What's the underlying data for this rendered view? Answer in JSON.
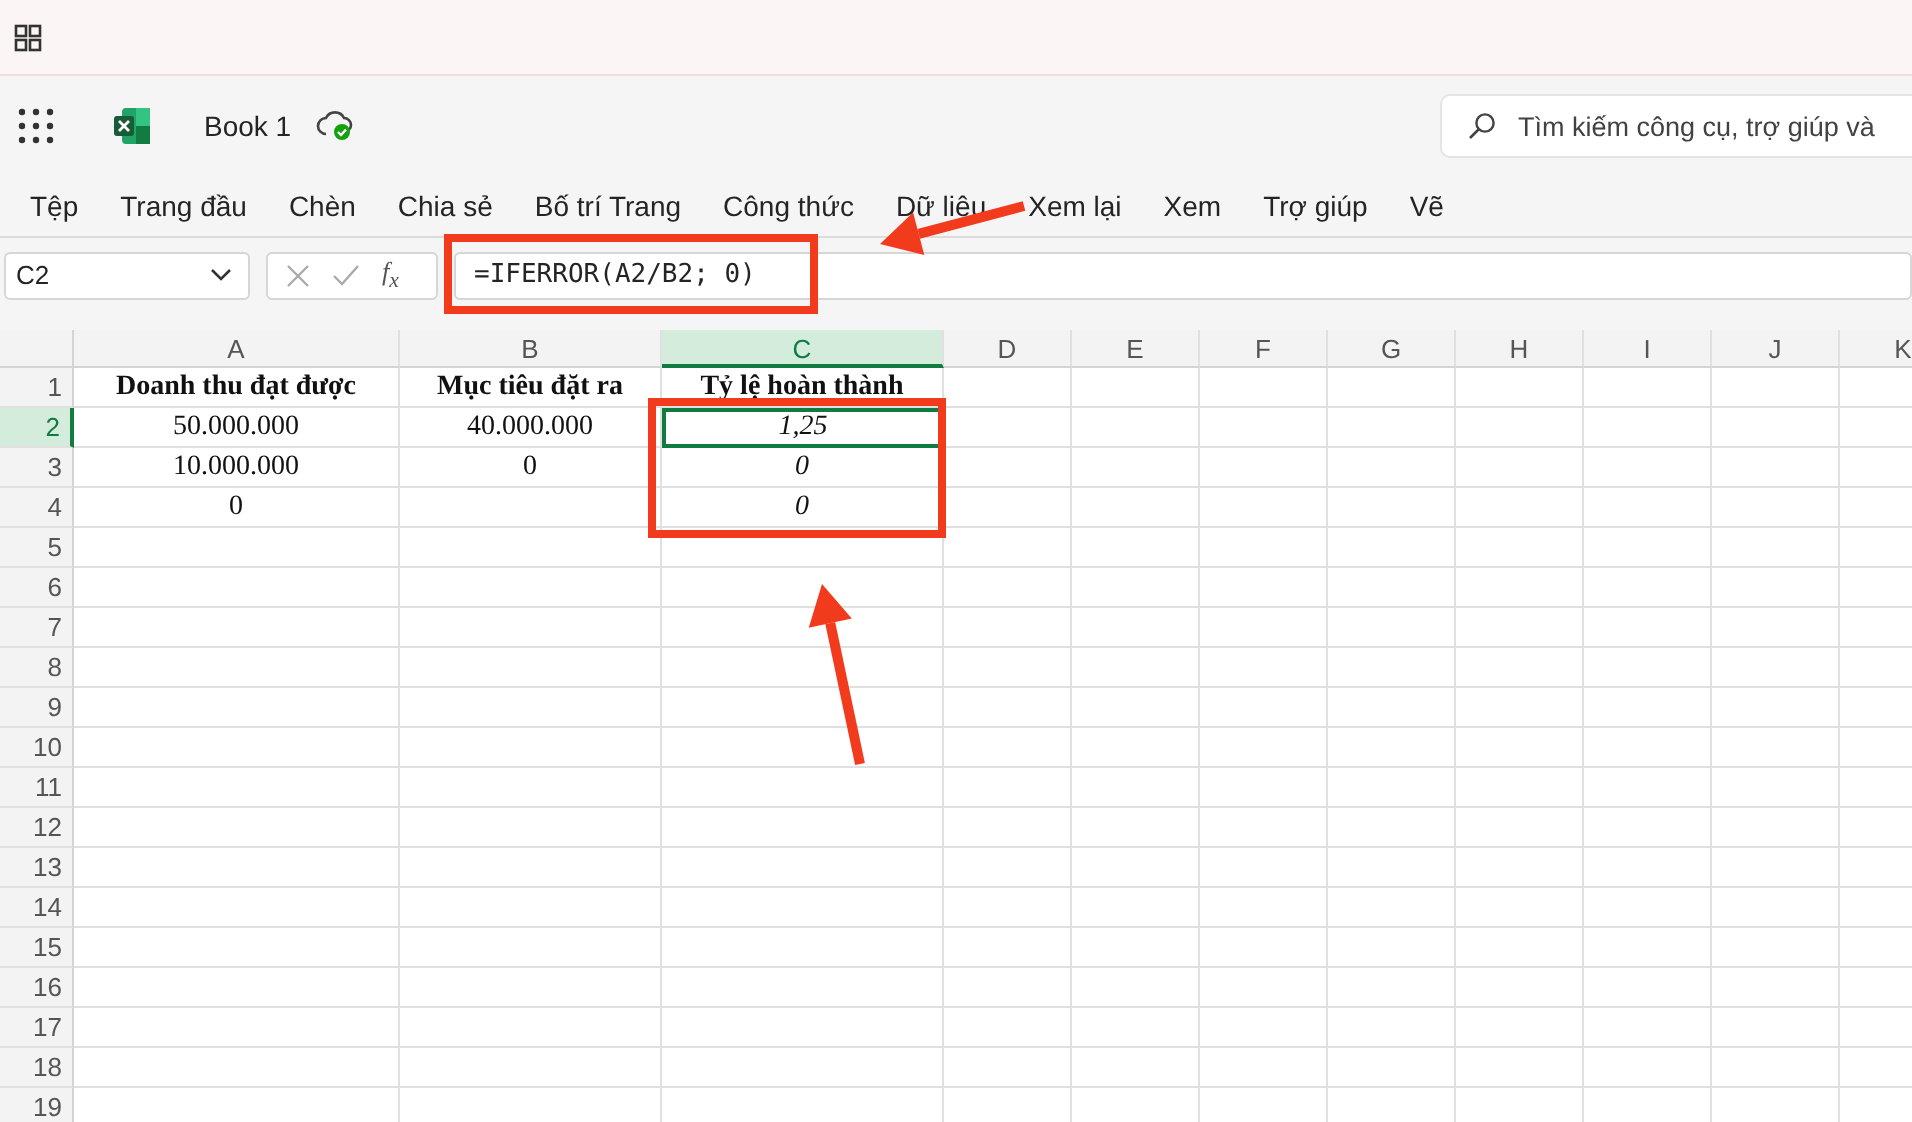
{
  "app": {
    "title": "Book 1"
  },
  "search": {
    "placeholder": "Tìm kiếm công cụ, trợ giúp và"
  },
  "ribbon_tabs": [
    "Tệp",
    "Trang đầu",
    "Chèn",
    "Chia sẻ",
    "Bố trí Trang",
    "Công thức",
    "Dữ liệu",
    "Xem lại",
    "Xem",
    "Trợ giúp",
    "Vẽ"
  ],
  "name_box": {
    "value": "C2"
  },
  "formula_bar": {
    "function_label": "f$_{x}$",
    "formula": "=IFERROR(A2/B2; 0)"
  },
  "columns": [
    {
      "label": "A",
      "selected": false
    },
    {
      "label": "B",
      "selected": false
    },
    {
      "label": "C",
      "selected": true
    },
    {
      "label": "D",
      "selected": false
    },
    {
      "label": "E",
      "selected": false
    },
    {
      "label": "F",
      "selected": false
    },
    {
      "label": "G",
      "selected": false
    },
    {
      "label": "H",
      "selected": false
    },
    {
      "label": "I",
      "selected": false
    },
    {
      "label": "J",
      "selected": false
    },
    {
      "label": "K",
      "selected": false
    }
  ],
  "rows": [
    {
      "label": "1",
      "selected": false,
      "cells": [
        {
          "text": "Doanh thu đạt được",
          "bold": true,
          "italic": false
        },
        {
          "text": "Mục tiêu đặt ra",
          "bold": true,
          "italic": false
        },
        {
          "text": "Tỷ lệ hoàn thành",
          "bold": true,
          "italic": false
        }
      ]
    },
    {
      "label": "2",
      "selected": true,
      "cells": [
        {
          "text": "50.000.000",
          "bold": false,
          "italic": false
        },
        {
          "text": "40.000.000",
          "bold": false,
          "italic": false
        },
        {
          "text": "1,25",
          "bold": false,
          "italic": true
        }
      ]
    },
    {
      "label": "3",
      "selected": false,
      "cells": [
        {
          "text": "10.000.000",
          "bold": false,
          "italic": false
        },
        {
          "text": "0",
          "bold": false,
          "italic": false
        },
        {
          "text": "0",
          "bold": false,
          "italic": true
        }
      ]
    },
    {
      "label": "4",
      "selected": false,
      "cells": [
        {
          "text": "0",
          "bold": false,
          "italic": false
        },
        null,
        {
          "text": "0",
          "bold": false,
          "italic": true
        }
      ]
    },
    {
      "label": "5",
      "selected": false
    },
    {
      "label": "6",
      "selected": false
    },
    {
      "label": "7",
      "selected": false
    },
    {
      "label": "8",
      "selected": false
    },
    {
      "label": "9",
      "selected": false
    },
    {
      "label": "10",
      "selected": false
    },
    {
      "label": "11",
      "selected": false
    },
    {
      "label": "12",
      "selected": false
    },
    {
      "label": "13",
      "selected": false
    },
    {
      "label": "14",
      "selected": false
    },
    {
      "label": "15",
      "selected": false
    },
    {
      "label": "16",
      "selected": false
    },
    {
      "label": "17",
      "selected": false
    },
    {
      "label": "18",
      "selected": false
    },
    {
      "label": "19",
      "selected": false
    }
  ],
  "annotations": [
    {
      "kind": "box"
    },
    {
      "kind": "arrow"
    },
    {
      "kind": "box"
    },
    {
      "kind": "arrow"
    }
  ]
}
